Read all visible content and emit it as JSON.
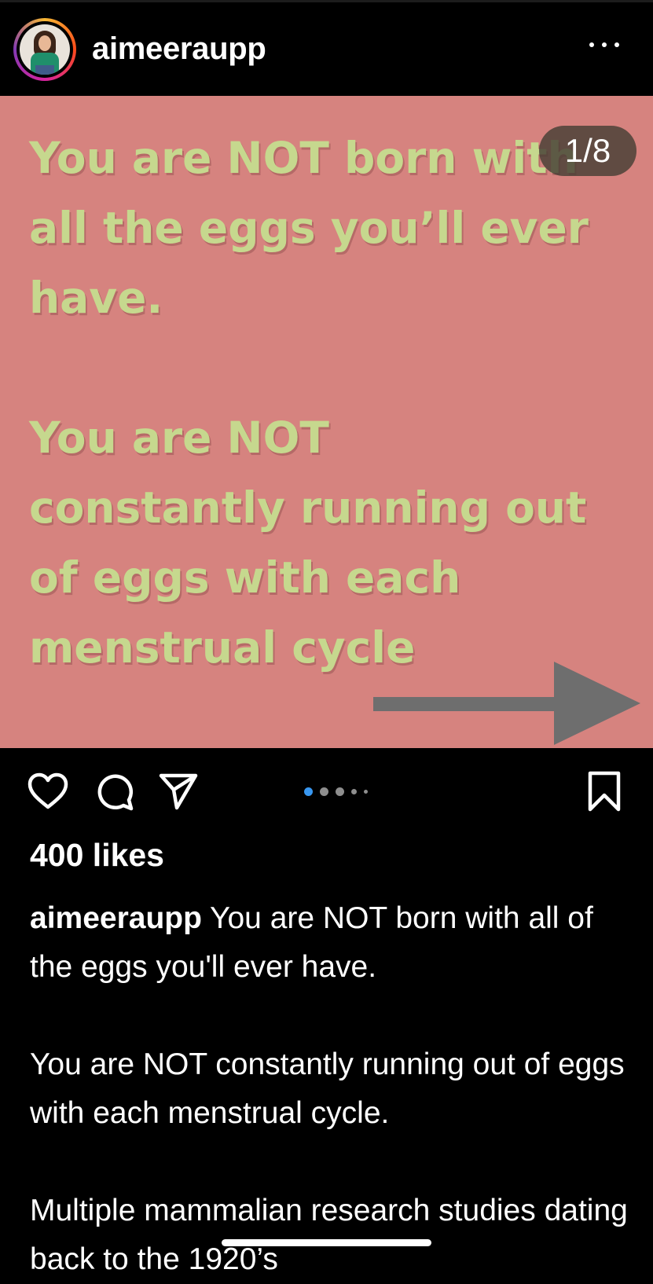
{
  "post": {
    "username": "aimeeraupp",
    "avatar_icon": "profile-photo",
    "slide_counter": "1/8",
    "slide_background": "#d6837f",
    "slide_text_color": "#c6d88e",
    "slide_text": {
      "line1": "You are NOT born with",
      "line2": "all the eggs you’ll ever",
      "line3": "have.",
      "line4": "You are NOT",
      "line5": "constantly running out",
      "line6": "of eggs with each",
      "line7": "menstrual cycle"
    },
    "carousel": {
      "current_index": 1,
      "visible_dots": 5,
      "active_color": "#3897f0"
    },
    "actions": {
      "like_icon": "heart-icon",
      "comment_icon": "comment-icon",
      "share_icon": "send-icon",
      "save_icon": "bookmark-icon"
    },
    "likes": "400 likes",
    "caption": {
      "username": "aimeeraupp",
      "p1": " You are NOT born with all of the eggs you'll ever have.",
      "p2": "You are NOT constantly running out of eggs with each menstrual cycle.",
      "p3": "Multiple mammalian research studies dating back to the 1920’s"
    }
  }
}
